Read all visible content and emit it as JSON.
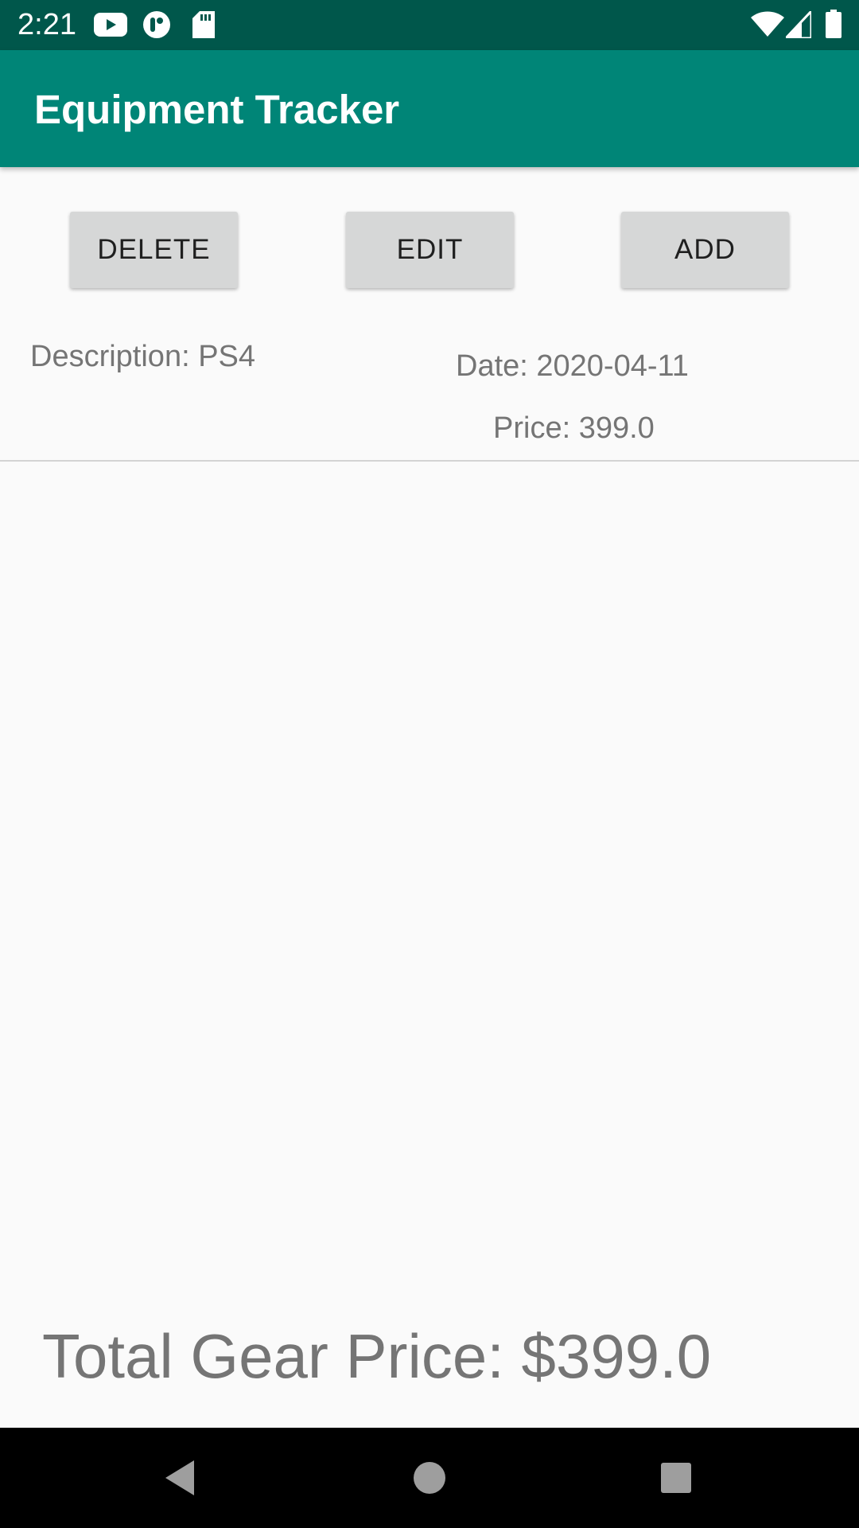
{
  "status_bar": {
    "time": "2:21",
    "left_icons": [
      "youtube-icon",
      "tasks-app-icon",
      "sd-card-icon"
    ],
    "right_icons": [
      "wifi-icon",
      "cell-signal-icon",
      "battery-icon"
    ]
  },
  "app_bar": {
    "title": "Equipment Tracker"
  },
  "actions": {
    "delete_label": "DELETE",
    "edit_label": "EDIT",
    "add_label": "ADD"
  },
  "items": [
    {
      "description": "Description: PS4",
      "date": "Date: 2020-04-11",
      "price": "Price: 399.0"
    }
  ],
  "footer": {
    "total": "Total Gear Price: $399.0"
  },
  "nav_bar": {
    "buttons": [
      "back-icon",
      "home-icon",
      "recents-icon"
    ]
  },
  "colors": {
    "status_bar": "#00574b",
    "primary": "#008577",
    "background": "#fafafa",
    "button": "#d6d7d7",
    "secondary_text": "#757575"
  }
}
